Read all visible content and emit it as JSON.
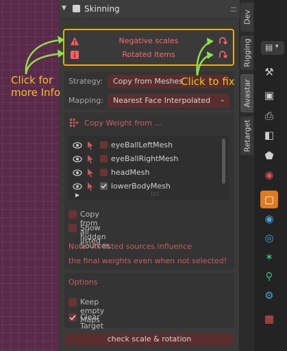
{
  "panel": {
    "title": "Skinning",
    "warnings": [
      {
        "text": "Negative scales",
        "icon": "warning-triangle-icon"
      },
      {
        "text": "Rotated Items",
        "icon": "info-icon"
      }
    ],
    "strategy_label": "Strategy:",
    "strategy_value": "Copy from Meshes",
    "mapping_label": "Mapping:",
    "mapping_value": "Nearest Face Interpolated",
    "copy_weight_label": "Copy Weight from ...",
    "sources": [
      {
        "name": "eyeBallLeftMesh",
        "checked": false
      },
      {
        "name": "eyeBallRightMesh",
        "checked": false
      },
      {
        "name": "headMesh",
        "checked": false
      },
      {
        "name": "lowerBodyMesh",
        "checked": true
      }
    ],
    "list_more": "::::",
    "copy_all_label": "Copy from all listed",
    "show_hidden_label": "Show hidden Sources",
    "note_line1": "Note: All listed sources influence",
    "note_line2": "the final weights even when not selected!",
    "options_label": "Options",
    "keep_empty_label": "Keep empty Maps",
    "clear_target_label": "Clear Target maps",
    "check_button": "check scale & rotation"
  },
  "tabs": [
    "Dev",
    "Rigging",
    "Avastar",
    "Retarget"
  ],
  "active_tab": "Avastar",
  "annotations": {
    "info": "Click for\nmore Info",
    "fix": "Click to fix"
  },
  "colors": {
    "highlight": "#e8b000",
    "warning_text": "#ff6b6b",
    "note_text": "#cc5b5b",
    "accent": "#e07a1e"
  }
}
